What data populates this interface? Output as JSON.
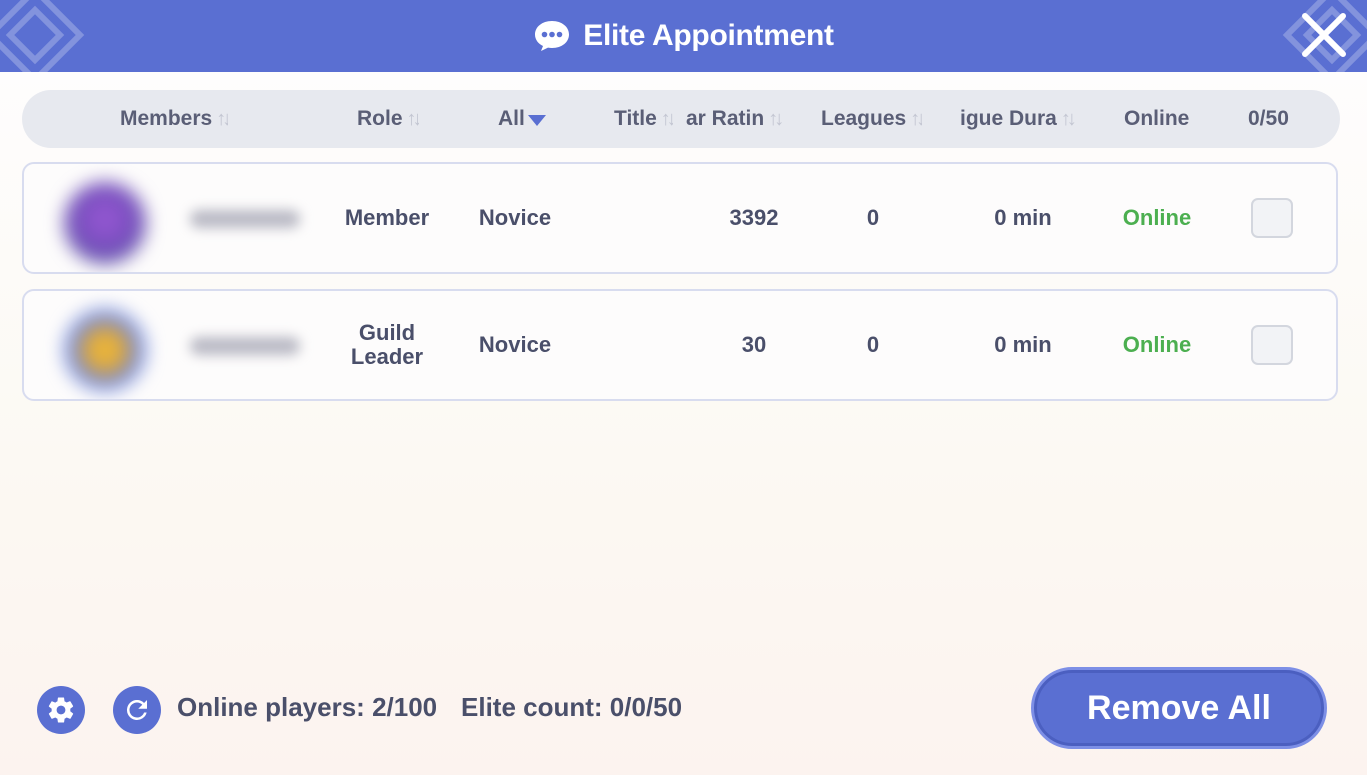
{
  "dialog": {
    "title": "Elite Appointment"
  },
  "table": {
    "headers": {
      "members": "Members",
      "role": "Role",
      "filter": "All",
      "title": "Title",
      "rating": "ar Ratin",
      "leagues": "Leagues",
      "duration": "igue Dura",
      "online": "Online",
      "count": "0/50"
    },
    "rows": [
      {
        "role": "Member",
        "title": "Novice",
        "rating": "3392",
        "leagues": "0",
        "duration": "0 min",
        "online": "Online",
        "checked": false
      },
      {
        "role_line1": "Guild",
        "role_line2": "Leader",
        "title": "Novice",
        "rating": "30",
        "leagues": "0",
        "duration": "0 min",
        "online": "Online",
        "checked": false
      }
    ]
  },
  "footer": {
    "online_players": "Online players: 2/100",
    "elite_count": "Elite count: 0/0/50",
    "remove_all_label": "Remove All"
  },
  "icons": {
    "chat": "chat-bubble-icon",
    "close": "close-icon",
    "settings": "gear-icon",
    "refresh": "refresh-icon",
    "sort": "sort-arrows-icon",
    "dropdown": "caret-down-icon"
  },
  "colors": {
    "accent": "#5a6fd2",
    "online": "#4caf50",
    "text": "#4a4f6a",
    "header_bar": "#e7e9ef"
  }
}
